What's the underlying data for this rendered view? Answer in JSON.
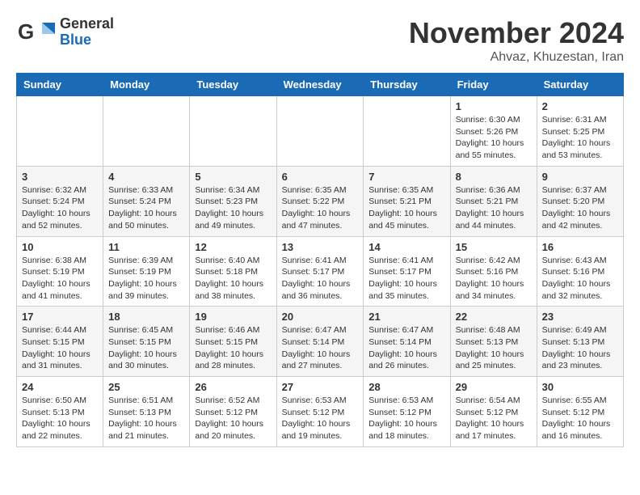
{
  "header": {
    "logo_general": "General",
    "logo_blue": "Blue",
    "month_title": "November 2024",
    "location": "Ahvaz, Khuzestan, Iran"
  },
  "weekdays": [
    "Sunday",
    "Monday",
    "Tuesday",
    "Wednesday",
    "Thursday",
    "Friday",
    "Saturday"
  ],
  "weeks": [
    [
      {
        "day": "",
        "info": ""
      },
      {
        "day": "",
        "info": ""
      },
      {
        "day": "",
        "info": ""
      },
      {
        "day": "",
        "info": ""
      },
      {
        "day": "",
        "info": ""
      },
      {
        "day": "1",
        "info": "Sunrise: 6:30 AM\nSunset: 5:26 PM\nDaylight: 10 hours and 55 minutes."
      },
      {
        "day": "2",
        "info": "Sunrise: 6:31 AM\nSunset: 5:25 PM\nDaylight: 10 hours and 53 minutes."
      }
    ],
    [
      {
        "day": "3",
        "info": "Sunrise: 6:32 AM\nSunset: 5:24 PM\nDaylight: 10 hours and 52 minutes."
      },
      {
        "day": "4",
        "info": "Sunrise: 6:33 AM\nSunset: 5:24 PM\nDaylight: 10 hours and 50 minutes."
      },
      {
        "day": "5",
        "info": "Sunrise: 6:34 AM\nSunset: 5:23 PM\nDaylight: 10 hours and 49 minutes."
      },
      {
        "day": "6",
        "info": "Sunrise: 6:35 AM\nSunset: 5:22 PM\nDaylight: 10 hours and 47 minutes."
      },
      {
        "day": "7",
        "info": "Sunrise: 6:35 AM\nSunset: 5:21 PM\nDaylight: 10 hours and 45 minutes."
      },
      {
        "day": "8",
        "info": "Sunrise: 6:36 AM\nSunset: 5:21 PM\nDaylight: 10 hours and 44 minutes."
      },
      {
        "day": "9",
        "info": "Sunrise: 6:37 AM\nSunset: 5:20 PM\nDaylight: 10 hours and 42 minutes."
      }
    ],
    [
      {
        "day": "10",
        "info": "Sunrise: 6:38 AM\nSunset: 5:19 PM\nDaylight: 10 hours and 41 minutes."
      },
      {
        "day": "11",
        "info": "Sunrise: 6:39 AM\nSunset: 5:19 PM\nDaylight: 10 hours and 39 minutes."
      },
      {
        "day": "12",
        "info": "Sunrise: 6:40 AM\nSunset: 5:18 PM\nDaylight: 10 hours and 38 minutes."
      },
      {
        "day": "13",
        "info": "Sunrise: 6:41 AM\nSunset: 5:17 PM\nDaylight: 10 hours and 36 minutes."
      },
      {
        "day": "14",
        "info": "Sunrise: 6:41 AM\nSunset: 5:17 PM\nDaylight: 10 hours and 35 minutes."
      },
      {
        "day": "15",
        "info": "Sunrise: 6:42 AM\nSunset: 5:16 PM\nDaylight: 10 hours and 34 minutes."
      },
      {
        "day": "16",
        "info": "Sunrise: 6:43 AM\nSunset: 5:16 PM\nDaylight: 10 hours and 32 minutes."
      }
    ],
    [
      {
        "day": "17",
        "info": "Sunrise: 6:44 AM\nSunset: 5:15 PM\nDaylight: 10 hours and 31 minutes."
      },
      {
        "day": "18",
        "info": "Sunrise: 6:45 AM\nSunset: 5:15 PM\nDaylight: 10 hours and 30 minutes."
      },
      {
        "day": "19",
        "info": "Sunrise: 6:46 AM\nSunset: 5:15 PM\nDaylight: 10 hours and 28 minutes."
      },
      {
        "day": "20",
        "info": "Sunrise: 6:47 AM\nSunset: 5:14 PM\nDaylight: 10 hours and 27 minutes."
      },
      {
        "day": "21",
        "info": "Sunrise: 6:47 AM\nSunset: 5:14 PM\nDaylight: 10 hours and 26 minutes."
      },
      {
        "day": "22",
        "info": "Sunrise: 6:48 AM\nSunset: 5:13 PM\nDaylight: 10 hours and 25 minutes."
      },
      {
        "day": "23",
        "info": "Sunrise: 6:49 AM\nSunset: 5:13 PM\nDaylight: 10 hours and 23 minutes."
      }
    ],
    [
      {
        "day": "24",
        "info": "Sunrise: 6:50 AM\nSunset: 5:13 PM\nDaylight: 10 hours and 22 minutes."
      },
      {
        "day": "25",
        "info": "Sunrise: 6:51 AM\nSunset: 5:13 PM\nDaylight: 10 hours and 21 minutes."
      },
      {
        "day": "26",
        "info": "Sunrise: 6:52 AM\nSunset: 5:12 PM\nDaylight: 10 hours and 20 minutes."
      },
      {
        "day": "27",
        "info": "Sunrise: 6:53 AM\nSunset: 5:12 PM\nDaylight: 10 hours and 19 minutes."
      },
      {
        "day": "28",
        "info": "Sunrise: 6:53 AM\nSunset: 5:12 PM\nDaylight: 10 hours and 18 minutes."
      },
      {
        "day": "29",
        "info": "Sunrise: 6:54 AM\nSunset: 5:12 PM\nDaylight: 10 hours and 17 minutes."
      },
      {
        "day": "30",
        "info": "Sunrise: 6:55 AM\nSunset: 5:12 PM\nDaylight: 10 hours and 16 minutes."
      }
    ]
  ]
}
